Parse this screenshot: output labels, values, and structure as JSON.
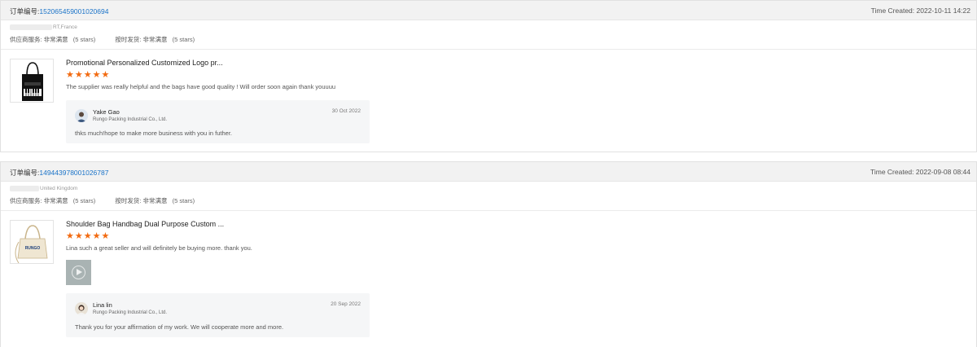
{
  "orders": [
    {
      "order_label": "订单编号:",
      "order_number": "152065459001020694",
      "time_created": "Time Created: 2022-10-11 14:22",
      "buyer_country": "RT,France",
      "supplier_service_label": "供应商服务: 非常满意",
      "supplier_service_stars": "(5 stars)",
      "on_time_label": "按时发货: 非常满意",
      "on_time_stars": "(5 stars)",
      "product_title": "Promotional Personalized Customized Logo pr...",
      "rating": "★★★★★",
      "comment": "The supplier was really helpful and the bags have good quality ! Will order soon again thank youuuu",
      "reply": {
        "name": "Yake Gao",
        "company": "Rungo Packing Industrial Co., Ltd.",
        "date": "30 Oct 2022",
        "text": "thks much!hope to make more business with you in futher."
      }
    },
    {
      "order_label": "订单编号:",
      "order_number": "149443978001026787",
      "time_created": "Time Created: 2022-09-08 08:44",
      "buyer_country": "United Kingdom",
      "supplier_service_label": "供应商服务: 非常满意",
      "supplier_service_stars": "(5 stars)",
      "on_time_label": "按时发货: 非常满意",
      "on_time_stars": "(5 stars)",
      "product_title": "Shoulder Bag Handbag Dual Purpose Custom ...",
      "rating": "★★★★★",
      "comment": "Lina such a great seller and will definitely be buying more. thank you.",
      "product_image_text": "RUNGO",
      "reply": {
        "name": "Lina lin",
        "company": "Rungo Packing Industrial Co., Ltd.",
        "date": "20 Sep 2022",
        "text": "Thank you for your affirmation of my work. We will cooperate more and more."
      }
    }
  ],
  "colors": {
    "accent_link": "#1a73c8",
    "star": "#f26a10",
    "header_bg": "#f2f2f2",
    "reply_bg": "#f5f6f7"
  }
}
